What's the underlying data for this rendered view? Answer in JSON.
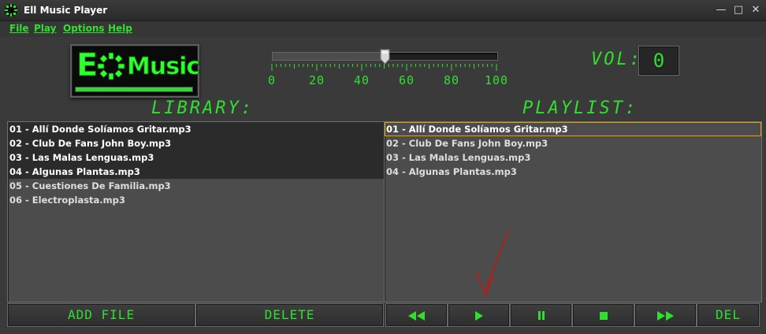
{
  "window": {
    "title": "Ell Music Player",
    "icon": "app-ring-icon",
    "controls": [
      "minimize-icon",
      "maximize-icon",
      "close-icon"
    ]
  },
  "menu": [
    {
      "label": "File"
    },
    {
      "label": "Play"
    },
    {
      "label": "Options"
    },
    {
      "label": "Help"
    }
  ],
  "logo": {
    "letter": "E",
    "word": "Music",
    "progress_fraction": 1.0
  },
  "seek": {
    "position_percent": 50,
    "ticks": [
      "0",
      "20",
      "40",
      "60",
      "80",
      "100"
    ]
  },
  "volume": {
    "label": "VOL:",
    "value": "0"
  },
  "library": {
    "title": "LIBRARY:",
    "items": [
      {
        "label": "01 - Allí Donde Solíamos Gritar.mp3",
        "selected": true
      },
      {
        "label": "02 - Club De Fans John Boy.mp3",
        "selected": true
      },
      {
        "label": "03 - Las Malas Lenguas.mp3",
        "selected": true
      },
      {
        "label": "04 - Algunas Plantas.mp3",
        "selected": true
      },
      {
        "label": "05 - Cuestiones De Familia.mp3",
        "selected": false
      },
      {
        "label": "06 - Electroplasta.mp3",
        "selected": false
      }
    ],
    "buttons": {
      "add": "ADD FILE",
      "delete": "DELETE"
    }
  },
  "playlist": {
    "title": "PLAYLIST:",
    "items": [
      {
        "label": "01 - Allí Donde Solíamos Gritar.mp3",
        "focused": true
      },
      {
        "label": "02 - Club De Fans John Boy.mp3",
        "focused": false
      },
      {
        "label": "03 - Las Malas Lenguas.mp3",
        "focused": false
      },
      {
        "label": "04 - Algunas Plantas.mp3",
        "focused": false
      }
    ],
    "buttons": {
      "del": "DEL"
    }
  },
  "transport": [
    "rewind-icon",
    "play-icon",
    "pause-icon",
    "stop-icon",
    "fast-forward-icon"
  ],
  "colors": {
    "accent": "#2fe02f",
    "background": "#3a3a3a",
    "panel": "#4c4c4c",
    "annotation": "#cc1111"
  }
}
